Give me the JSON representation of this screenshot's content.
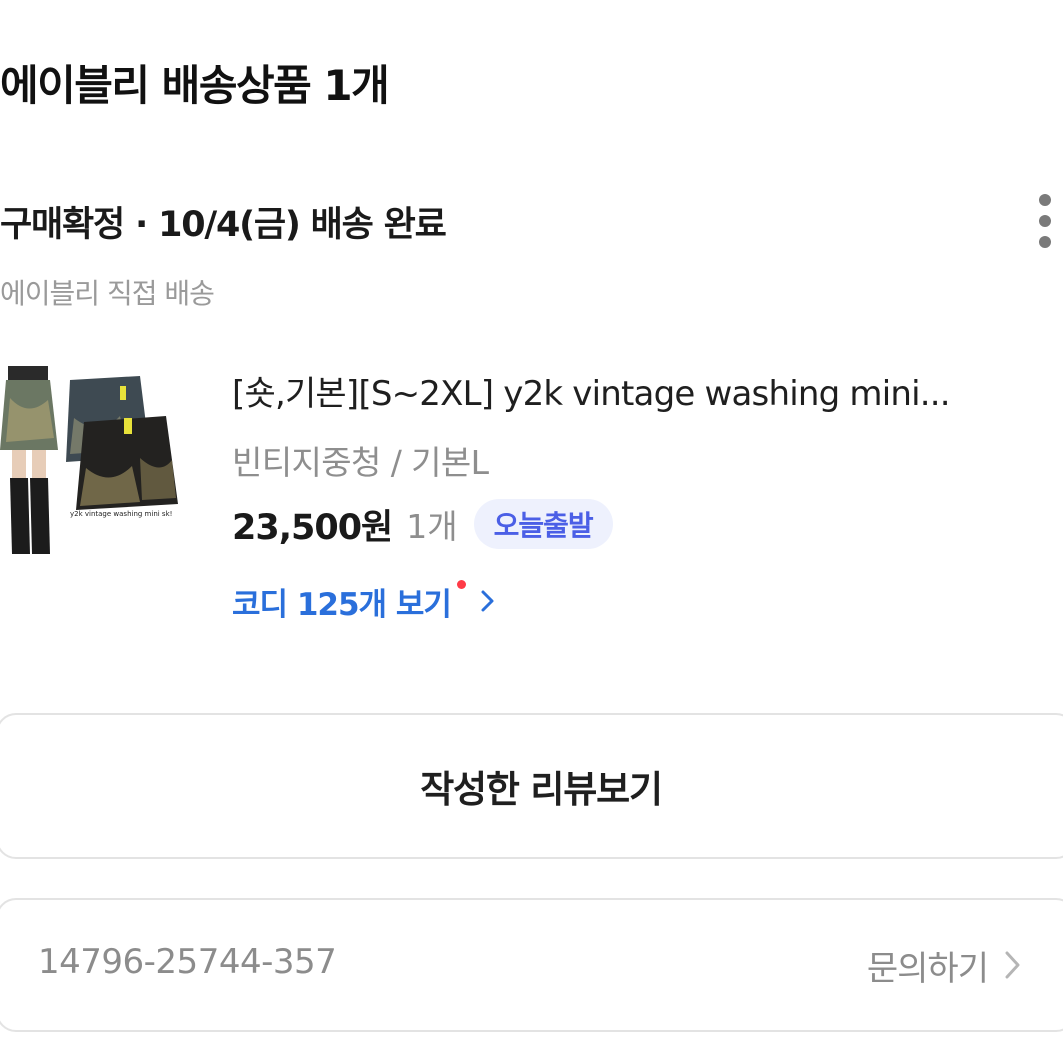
{
  "header": {
    "title": "에이블리 배송상품 1개"
  },
  "order": {
    "status": "구매확정 · 10/4(금) 배송 완료",
    "shipper": "에이블리 직접 배송",
    "more_icon": "more-vertical-icon"
  },
  "product": {
    "image_caption": "y2k vintage washing mini sk!",
    "name": "[숏,기본][S~2XL] y2k vintage washing mini...",
    "option": "빈티지중청 / 기본L",
    "price": "23,500원",
    "quantity": "1개",
    "badge": "오늘출발",
    "cody_link": "코디 125개 보기",
    "colors": {
      "link": "#2a6fdb",
      "badge_text": "#4b5fe6",
      "badge_bg": "#eef1fd",
      "dot": "#ff3b47"
    }
  },
  "actions": {
    "review_button": "작성한 리뷰보기"
  },
  "footer": {
    "order_number": "14796-25744-357",
    "inquiry": "문의하기"
  }
}
